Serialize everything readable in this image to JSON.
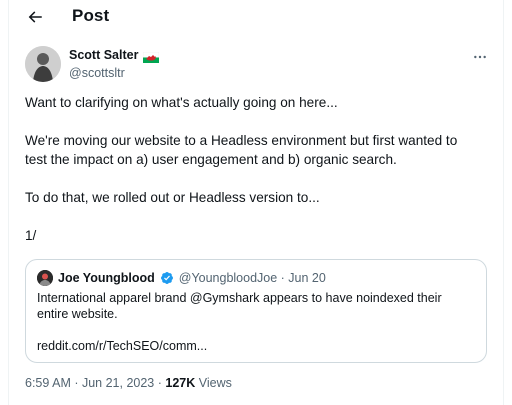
{
  "header": {
    "title": "Post",
    "back_icon": "arrow-left-icon"
  },
  "author": {
    "display_name": "Scott Salter",
    "flag_icon": "wales-flag-icon",
    "handle": "@scottsltr",
    "more_icon": "more-horizontal-icon"
  },
  "tweet": {
    "paragraphs": [
      "Want to clarifying on what's actually going on here...",
      "We're moving our website to a Headless environment but first wanted to",
      "test the impact on a) user engagement and b) organic search.",
      "To do that, we rolled out or Headless version to...",
      "1/"
    ]
  },
  "quote": {
    "display_name": "Joe Youngblood",
    "verified_icon": "verified-badge-icon",
    "handle_date": "@YoungbloodJoe · Jun 20",
    "body_line1": "International apparel brand @Gymshark appears to have noindexed their",
    "body_line2": "entire website.",
    "link": "reddit.com/r/TechSEO/comm..."
  },
  "meta": {
    "timestamp": "6:59 AM · Jun 21, 2023 · ",
    "views_count": "127K",
    "views_label": " Views"
  },
  "colors": {
    "text": "#0f1419",
    "secondary": "#536471",
    "border": "#cfd9de",
    "verified": "#1d9bf0"
  }
}
